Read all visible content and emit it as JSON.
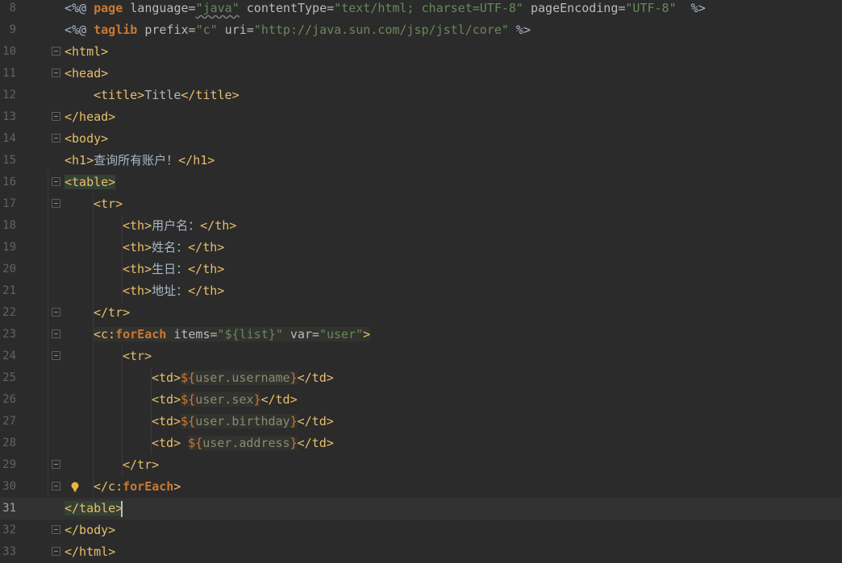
{
  "editor": {
    "current_line": 31,
    "lines": [
      {
        "n": "8",
        "indent": 0,
        "fold": false,
        "parts": [
          [
            "txt",
            "<%@ "
          ],
          [
            "kw",
            "page "
          ],
          [
            "attr",
            "language="
          ],
          [
            "str-squig",
            "\"java\""
          ],
          [
            "attr",
            " contentType="
          ],
          [
            "str",
            "\"text/html; charset=UTF-8\""
          ],
          [
            "attr",
            " pageEncoding="
          ],
          [
            "str",
            "\"UTF-8\""
          ],
          [
            "txt",
            "  %>"
          ]
        ]
      },
      {
        "n": "9",
        "indent": 0,
        "fold": false,
        "parts": [
          [
            "txt",
            "<%@ "
          ],
          [
            "kw",
            "taglib "
          ],
          [
            "attr",
            "prefix="
          ],
          [
            "str",
            "\"c\""
          ],
          [
            "attr",
            " uri="
          ],
          [
            "str",
            "\"http://java.sun.com/jsp/jstl/core\""
          ],
          [
            "txt",
            " %>"
          ]
        ]
      },
      {
        "n": "10",
        "indent": 0,
        "fold": true,
        "parts": [
          [
            "tag",
            "<html>"
          ]
        ]
      },
      {
        "n": "11",
        "indent": 0,
        "fold": true,
        "parts": [
          [
            "tag",
            "<head>"
          ]
        ]
      },
      {
        "n": "12",
        "indent": 1,
        "fold": false,
        "parts": [
          [
            "tag",
            "<title>"
          ],
          [
            "txt",
            "Title"
          ],
          [
            "tag",
            "</title>"
          ]
        ]
      },
      {
        "n": "13",
        "indent": 0,
        "fold": true,
        "parts": [
          [
            "tag",
            "</head>"
          ]
        ]
      },
      {
        "n": "14",
        "indent": 0,
        "fold": true,
        "parts": [
          [
            "tag",
            "<body>"
          ]
        ]
      },
      {
        "n": "15",
        "indent": 0,
        "fold": false,
        "parts": [
          [
            "tag",
            "<h1>"
          ],
          [
            "txt-cjk",
            "查询所有账户！"
          ],
          [
            "tag",
            "</h1>"
          ]
        ]
      },
      {
        "n": "16",
        "indent": 0,
        "fold": true,
        "parts": [
          [
            "tag-hl",
            "<table>"
          ]
        ]
      },
      {
        "n": "17",
        "indent": 1,
        "fold": true,
        "parts": [
          [
            "tag",
            "<tr>"
          ]
        ]
      },
      {
        "n": "18",
        "indent": 2,
        "fold": false,
        "parts": [
          [
            "tag",
            "<th>"
          ],
          [
            "txt-cjk",
            "用户名："
          ],
          [
            "tag",
            "</th>"
          ]
        ]
      },
      {
        "n": "19",
        "indent": 2,
        "fold": false,
        "parts": [
          [
            "tag",
            "<th>"
          ],
          [
            "txt-cjk",
            "姓名："
          ],
          [
            "tag",
            "</th>"
          ]
        ]
      },
      {
        "n": "20",
        "indent": 2,
        "fold": false,
        "parts": [
          [
            "tag",
            "<th>"
          ],
          [
            "txt-cjk",
            "生日："
          ],
          [
            "tag",
            "</th>"
          ]
        ]
      },
      {
        "n": "21",
        "indent": 2,
        "fold": false,
        "parts": [
          [
            "tag",
            "<th>"
          ],
          [
            "txt-cjk",
            "地址："
          ],
          [
            "tag",
            "</th>"
          ]
        ]
      },
      {
        "n": "22",
        "indent": 1,
        "fold": true,
        "parts": [
          [
            "tag",
            "</tr>"
          ]
        ]
      },
      {
        "n": "23",
        "indent": 1,
        "fold": true,
        "parts": [
          [
            "tag-box",
            "<c:"
          ],
          [
            "kw-box",
            "forEach"
          ],
          [
            "attr-box",
            " items="
          ],
          [
            "str-box",
            "\"${list}\""
          ],
          [
            "attr-box",
            " var="
          ],
          [
            "str-box",
            "\"user\""
          ],
          [
            "tag-box",
            ">"
          ]
        ]
      },
      {
        "n": "24",
        "indent": 2,
        "fold": true,
        "parts": [
          [
            "tag",
            "<tr>"
          ]
        ]
      },
      {
        "n": "25",
        "indent": 3,
        "fold": false,
        "parts": [
          [
            "tag",
            "<td>"
          ],
          [
            "kwplain",
            "${"
          ],
          [
            "el",
            "user.username"
          ],
          [
            "kwplain",
            "}"
          ],
          [
            "tag",
            "</td>"
          ]
        ]
      },
      {
        "n": "26",
        "indent": 3,
        "fold": false,
        "parts": [
          [
            "tag",
            "<td>"
          ],
          [
            "kwplain",
            "${"
          ],
          [
            "el",
            "user.sex"
          ],
          [
            "kwplain",
            "}"
          ],
          [
            "tag",
            "</td>"
          ]
        ]
      },
      {
        "n": "27",
        "indent": 3,
        "fold": false,
        "parts": [
          [
            "tag",
            "<td>"
          ],
          [
            "kwplain",
            "${"
          ],
          [
            "el",
            "user.birthday"
          ],
          [
            "kwplain",
            "}"
          ],
          [
            "tag",
            "</td>"
          ]
        ]
      },
      {
        "n": "28",
        "indent": 3,
        "fold": false,
        "parts": [
          [
            "tag",
            "<td>"
          ],
          [
            "txt",
            " "
          ],
          [
            "kwplain",
            "${"
          ],
          [
            "el",
            "user.address"
          ],
          [
            "kwplain",
            "}"
          ],
          [
            "tag",
            "</td>"
          ]
        ]
      },
      {
        "n": "29",
        "indent": 2,
        "fold": true,
        "parts": [
          [
            "tag",
            "</tr>"
          ]
        ]
      },
      {
        "n": "30",
        "indent": 1,
        "fold": true,
        "bulb": true,
        "parts": [
          [
            "tag",
            "</c:"
          ],
          [
            "kw",
            "forEach"
          ],
          [
            "tag",
            ">"
          ]
        ]
      },
      {
        "n": "31",
        "indent": 0,
        "fold": false,
        "caret": true,
        "parts": [
          [
            "tag-hl",
            "</table>"
          ]
        ]
      },
      {
        "n": "32",
        "indent": 0,
        "fold": true,
        "parts": [
          [
            "tag",
            "</body>"
          ]
        ]
      },
      {
        "n": "33",
        "indent": 0,
        "fold": true,
        "parts": [
          [
            "tag",
            "</html>"
          ]
        ]
      }
    ]
  },
  "icons": {
    "fold_marker": "fold-toggle-icon",
    "intention": "lightbulb-icon"
  },
  "colors": {
    "background": "#2b2b2b",
    "tag": "#e8bf6a",
    "attribute": "#bababa",
    "string": "#6a8759",
    "keyword": "#cc7832",
    "text": "#a9b7c6",
    "line_number": "#606366",
    "matched_tag_highlight": "#344134"
  }
}
